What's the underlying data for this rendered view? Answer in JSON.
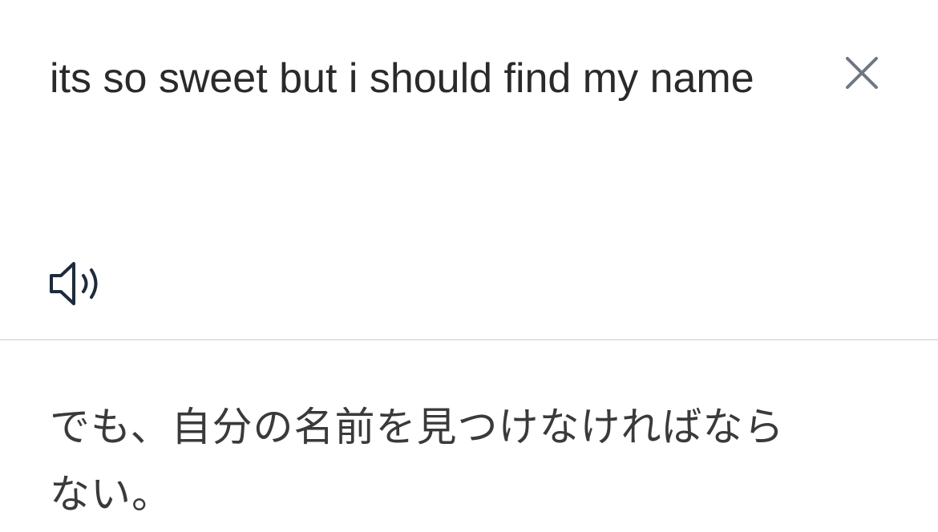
{
  "source": {
    "text": "its so sweet but i should find my name",
    "close_icon": "close-icon",
    "speaker_icon": "speaker-icon"
  },
  "translation": {
    "text": "でも、自分の名前を見つけなければならない。"
  },
  "colors": {
    "background": "#ffffff",
    "text_primary": "#2a2a2a",
    "text_secondary": "#3a3a3a",
    "icon_gray": "#6f7782",
    "icon_dark": "#1f2a3c",
    "divider": "#e3e4e6"
  }
}
